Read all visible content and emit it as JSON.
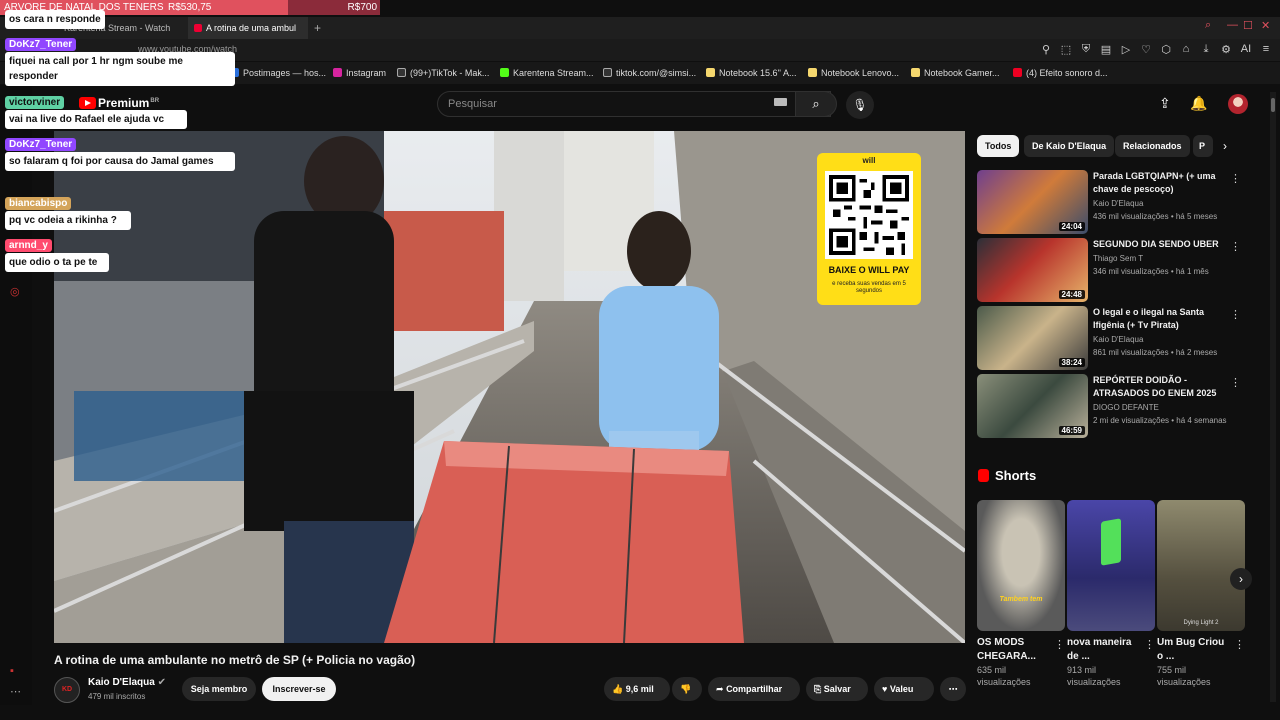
{
  "donation_goal": {
    "label": "ARVORE DE NATAL DOS TENERS",
    "current": "R$530,75",
    "target": "R$700",
    "progress": 0.758
  },
  "browser": {
    "tabs": [
      {
        "label": "Karentena Stream - Watch"
      },
      {
        "label": "A rotina de uma ambul"
      }
    ],
    "new_tab": "+",
    "url": "www.youtube.com/watch",
    "bookmarks": [
      "Postimages — hos...",
      "Instagram",
      "(99+)TikTok - Mak...",
      "Karentena Stream...",
      "tiktok.com/@simsi...",
      "Notebook 15.6'' A...",
      "Notebook Lenovo...",
      "Notebook Gamer...",
      "(4) Efeito sonoro d..."
    ],
    "ai_label": "AI"
  },
  "chat": [
    {
      "user": "",
      "text": "os cara n responde",
      "user_color": "#7a3cff"
    },
    {
      "user": "DoKz7_Tener",
      "text": "fiquei na call por 1 hr ngm soube me responder",
      "user_color": "#9147ff"
    },
    {
      "user": "victorviner",
      "text": "vai na live do Rafael ele ajuda vc",
      "user_color": "#5fd1a4"
    },
    {
      "user": "DoKz7_Tener",
      "text": "so falaram q foi por causa do Jamal games",
      "user_color": "#9147ff"
    },
    {
      "user": "biancabispo",
      "text": "pq vc odeia a rikinha ?",
      "user_color": "#d4a45a"
    },
    {
      "user": "arnnd_y",
      "text": "que odio o ta pe te",
      "user_color": "#ff4b6e"
    }
  ],
  "youtube": {
    "logo": "Premium",
    "country": "BR",
    "search_placeholder": "Pesquisar",
    "video": {
      "title": "A rotina de uma ambulante no metrô de SP (+ Policia no vagão)",
      "channel": "Kaio D'Elaqua",
      "subscribers": "479 mil inscritos",
      "join": "Seja membro",
      "subscribe": "Inscrever-se",
      "likes": "9,6 mil",
      "share": "Compartilhar",
      "save": "Salvar",
      "thanks": "Valeu",
      "ad": {
        "brand": "will",
        "title": "BAIXE O WILL PAY",
        "subtitle": "e receba suas vendas em 5 segundos"
      }
    },
    "chips": [
      "Todos",
      "De Kaio D'Elaqua",
      "Relacionados",
      "P"
    ],
    "recommendations": [
      {
        "title": "Parada LGBTQIAPN+ (+ uma chave de pescoço)",
        "channel": "Kaio D'Elaqua",
        "meta": "436 mil visualizações • há 5 meses",
        "duration": "24:04"
      },
      {
        "title": "SEGUNDO DIA SENDO UBER",
        "channel": "Thiago Sem T",
        "meta": "346 mil visualizações • há 1 mês",
        "duration": "24:48"
      },
      {
        "title": "O legal e o ilegal na Santa Ifigênia (+ Tv Pirata)",
        "channel": "Kaio D'Elaqua",
        "meta": "861 mil visualizações • há 2 meses",
        "duration": "38:24"
      },
      {
        "title": "REPÓRTER DOIDÃO - ATRASADOS DO ENEM 2025",
        "channel": "DIOGO DEFANTE",
        "meta": "2 mi de visualizações • há 4 semanas",
        "duration": "46:59"
      }
    ],
    "shorts_heading": "Shorts",
    "shorts": [
      {
        "title": "OS MODS CHEGARA...",
        "views": "635 mil visualizações",
        "caption": "Tambem tem"
      },
      {
        "title": "nova maneira de ...",
        "views": "913 mil visualizações",
        "caption": ""
      },
      {
        "title": "Um Bug Criou o ...",
        "views": "755 mil visualizações",
        "caption": "Dying Light 2"
      }
    ]
  }
}
